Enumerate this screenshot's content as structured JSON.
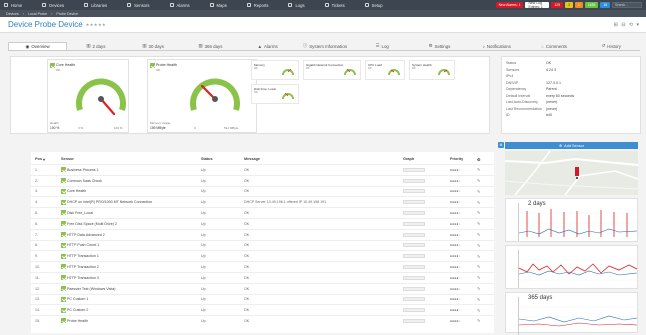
{
  "nav": {
    "items": [
      "Home",
      "Devices",
      "Libraries",
      "Sensors",
      "Alarms",
      "Maps",
      "Reports",
      "Logs",
      "Tickets",
      "Setup"
    ],
    "new_alarms": "New Alarms: 1",
    "new_log": "New Log Entries: 1",
    "red_count": "129",
    "yellow_count": "3",
    "orange_count": "1",
    "green_count": "1183",
    "blue_count": "15",
    "search_placeholder": "Search..."
  },
  "breadcrumb": [
    "Devices",
    "Local Probe",
    "Probe Device"
  ],
  "page": {
    "title": "Device Probe Device",
    "title_suffix": "★★★★★",
    "tools": "⊞ ⊟ ⟲ ▾"
  },
  "tabs": [
    {
      "label": "Overview",
      "icon": "eye-icon"
    },
    {
      "label": "2 days",
      "icon": "chart-icon"
    },
    {
      "label": "30 days",
      "icon": "chart-icon"
    },
    {
      "label": "365 days",
      "icon": "chart-icon"
    },
    {
      "label": "Alarms",
      "icon": "alarm-icon"
    },
    {
      "label": "System Information",
      "icon": "info-icon"
    },
    {
      "label": "Log",
      "icon": "log-icon"
    },
    {
      "label": "Settings",
      "icon": "gear-icon"
    },
    {
      "label": "Notifications",
      "icon": "bell-icon"
    },
    {
      "label": "Comments",
      "icon": "comment-icon"
    },
    {
      "label": "History",
      "icon": "history-icon"
    }
  ],
  "gauges": {
    "core": {
      "title": "Core Health",
      "state": "OK",
      "value_label": "Health",
      "value": "100 %",
      "min": "0 %",
      "max": "100 %"
    },
    "probe": {
      "title": "Probe Health",
      "state": "OK",
      "value_label": "Memory Usage",
      "value": "159 MByte",
      "min": "0",
      "max": "512 MByte"
    },
    "small": [
      {
        "title": "Memory",
        "sub": "OK"
      },
      {
        "title": "Gigabit Network Connection",
        "sub": "OK"
      },
      {
        "title": "CPU Load",
        "sub": "OK"
      },
      {
        "title": "System Health",
        "sub": "OK"
      },
      {
        "title": "Disk Free: Local",
        "sub": "OK"
      }
    ]
  },
  "info": {
    "rows": [
      {
        "k": "Status",
        "v": "OK"
      },
      {
        "k": "Sensors",
        "v": "4   24   3"
      },
      {
        "k": "IPv4",
        "v": ""
      },
      {
        "k": "DNS/IP",
        "v": "127.0.0.1"
      },
      {
        "k": "Dependency",
        "v": "Parent"
      },
      {
        "k": "Default Interval",
        "v": "every 60 seconds"
      },
      {
        "k": "Last Auto-Discovery",
        "v": "(never)"
      },
      {
        "k": "Last Recommendation",
        "v": "(never)"
      },
      {
        "k": "ID",
        "v": "#40"
      }
    ]
  },
  "add_sensor": "Add Sensor",
  "graphs": [
    {
      "label": "2 days"
    },
    {
      "label": "30 days"
    },
    {
      "label": "365 days"
    }
  ],
  "table": {
    "headers": {
      "pos": "Pos",
      "sensor": "Sensor",
      "status": "Status",
      "message": "Message",
      "graph": "Graph",
      "priority": "Priority"
    },
    "rows": [
      {
        "pos": "1.",
        "sensor": "Business Process 1",
        "status": "Up",
        "message": "OK"
      },
      {
        "pos": "2.",
        "sensor": "Common Saas Check",
        "status": "Up",
        "message": "OK"
      },
      {
        "pos": "3.",
        "sensor": "Core Health",
        "status": "Up",
        "message": "OK"
      },
      {
        "pos": "4.",
        "sensor": "DHCP on Intel(R) PRO/1000 MT Network Connection",
        "status": "Up",
        "message": "DHCP Server 10.49.198.1 offered IP 10.49.198.191"
      },
      {
        "pos": "5.",
        "sensor": "Disk Free_Local",
        "status": "Up",
        "message": "OK"
      },
      {
        "pos": "6.",
        "sensor": "Free Disk Space (Multi Drive) 2",
        "status": "Up",
        "message": "OK"
      },
      {
        "pos": "7.",
        "sensor": "HTTP Data Advanced 2",
        "status": "Up",
        "message": "OK"
      },
      {
        "pos": "8.",
        "sensor": "HTTP Push Count 1",
        "status": "Up",
        "message": "OK"
      },
      {
        "pos": "9.",
        "sensor": "HTTP Transaction 1",
        "status": "Up",
        "message": "OK"
      },
      {
        "pos": "10.",
        "sensor": "HTTP Transaction 2",
        "status": "Up",
        "message": "OK"
      },
      {
        "pos": "11.",
        "sensor": "HTTP Transaction 3",
        "status": "Up",
        "message": "OK"
      },
      {
        "pos": "12.",
        "sensor": "Paessler Test (Windows Vista)",
        "status": "Up",
        "message": "OK"
      },
      {
        "pos": "13.",
        "sensor": "PC Custom 1",
        "status": "Up",
        "message": "OK"
      },
      {
        "pos": "14.",
        "sensor": "PC Custom 2",
        "status": "Up",
        "message": "OK"
      },
      {
        "pos": "15.",
        "sensor": "Probe Health",
        "status": "Up",
        "message": "OK"
      }
    ]
  },
  "colors": {
    "accent": "#2f82c4",
    "ok": "#8bc34a",
    "nav": "#3d4650"
  }
}
